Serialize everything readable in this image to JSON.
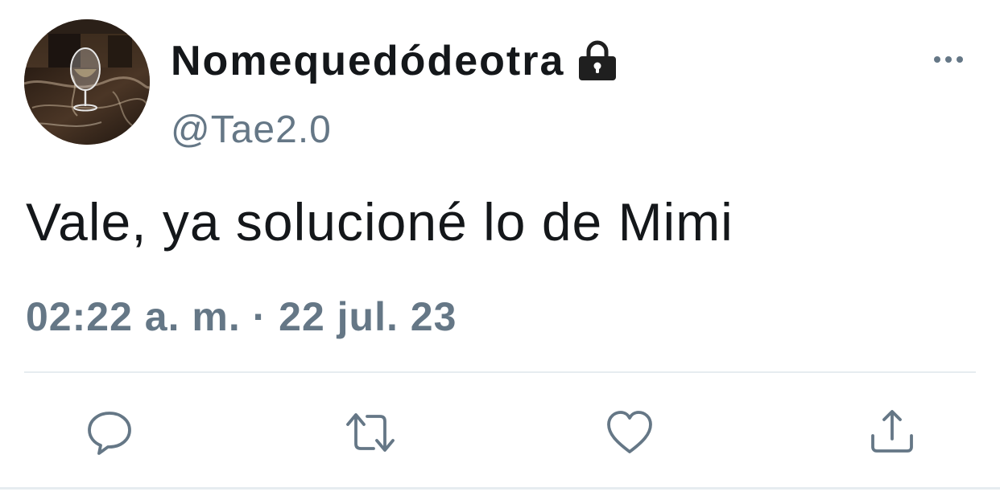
{
  "user": {
    "display_name": "Nomequedódeotra",
    "handle": "@Tae2.0",
    "protected_icon": "lock-icon",
    "avatar": "wine-glass-photo"
  },
  "tweet": {
    "text": "Vale, ya solucioné lo de Mimi",
    "timestamp": "02:22 a. m. · 22 jul. 23"
  },
  "menu": {
    "icon": "more-horizontal-icon"
  },
  "actions": [
    {
      "name": "reply",
      "icon": "reply-icon"
    },
    {
      "name": "retweet",
      "icon": "retweet-icon"
    },
    {
      "name": "like",
      "icon": "heart-icon"
    },
    {
      "name": "share",
      "icon": "share-icon"
    }
  ],
  "colors": {
    "text": "#14171a",
    "secondary": "#657786",
    "divider": "#e6ecf0"
  }
}
